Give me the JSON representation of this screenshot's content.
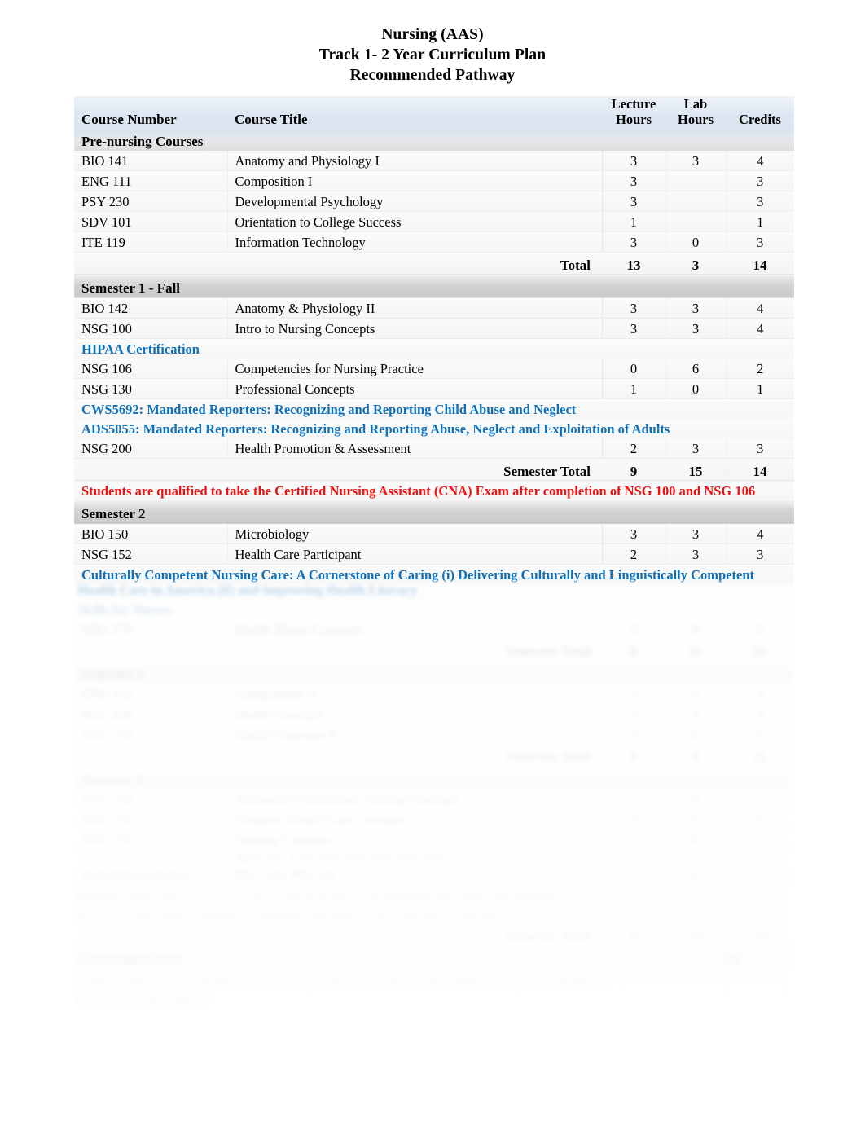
{
  "document": {
    "title_lines": [
      "Nursing (AAS)",
      "Track 1- 2 Year Curriculum Plan",
      "Recommended Pathway"
    ]
  },
  "colors": {
    "note_blue": "#1071b9",
    "note_red": "#ee1111",
    "header_blue_bg": "#d9e4f0",
    "section_gray_bg": "#d3d3d3"
  },
  "table": {
    "headers": {
      "course_number": "Course Number",
      "course_title": "Course Title",
      "lecture_hours": "Lecture\nHours",
      "lecture_hours_l1": "Lecture",
      "lecture_hours_l2": "Hours",
      "lab_hours_l1": "Lab",
      "lab_hours_l2": "Hours",
      "credits": "Credits"
    },
    "sections": [
      {
        "name": "Pre-nursing Courses",
        "style": "header-sub",
        "rows": [
          {
            "num": "BIO 141",
            "title": "Anatomy and Physiology I",
            "lecture": "3",
            "lab": "3",
            "credits": "4"
          },
          {
            "num": "ENG 111",
            "title": "Composition I",
            "lecture": "3",
            "lab": "",
            "credits": "3"
          },
          {
            "num": "PSY 230",
            "title": "Developmental Psychology",
            "lecture": "3",
            "lab": "",
            "credits": "3"
          },
          {
            "num": "SDV 101",
            "title": "Orientation to College Success",
            "lecture": "1",
            "lab": "",
            "credits": "1"
          },
          {
            "num": "ITE 119",
            "title": "Information Technology",
            "lecture": "3",
            "lab": "0",
            "credits": "3"
          }
        ],
        "total": {
          "label": "Total",
          "lecture": "13",
          "lab": "3",
          "credits": "14"
        }
      },
      {
        "name": "Semester 1 - Fall",
        "style": "section",
        "rows": [
          {
            "num": "BIO 142",
            "title": "Anatomy & Physiology II",
            "lecture": "3",
            "lab": "3",
            "credits": "4"
          },
          {
            "num": "NSG 100",
            "title": "Intro to Nursing Concepts",
            "lecture": "3",
            "lab": "3",
            "credits": "4"
          }
        ],
        "notes_after_rows": [
          {
            "text": "HIPAA Certification",
            "color": "blue"
          }
        ],
        "rows2": [
          {
            "num": "NSG 106",
            "title": "Competencies for Nursing Practice",
            "lecture": "0",
            "lab": "6",
            "credits": "2"
          },
          {
            "num": "NSG 130",
            "title": "Professional Concepts",
            "lecture": "1",
            "lab": "0",
            "credits": "1"
          }
        ],
        "notes2": [
          {
            "text": "CWS5692:  Mandated Reporters:  Recognizing and Reporting Child Abuse and Neglect",
            "color": "blue"
          },
          {
            "text": "ADS5055:  Mandated Reporters:  Recognizing and Reporting Abuse, Neglect and Exploitation of Adults",
            "color": "blue"
          }
        ],
        "rows3": [
          {
            "num": "NSG 200",
            "title": "Health Promotion & Assessment",
            "lecture": "2",
            "lab": "3",
            "credits": "3"
          }
        ],
        "total": {
          "label": "Semester Total",
          "lecture": "9",
          "lab": "15",
          "credits": "14"
        },
        "notes_end": [
          {
            "text": "Students are qualified to take the Certified Nursing Assistant (CNA) Exam after completion of NSG 100 and NSG 106",
            "color": "red"
          }
        ]
      },
      {
        "name": "Semester 2",
        "style": "section",
        "rows": [
          {
            "num": "BIO 150",
            "title": "Microbiology",
            "lecture": "3",
            "lab": "3",
            "credits": "4"
          },
          {
            "num": "NSG 152",
            "title": "Health Care Participant",
            "lecture": "2",
            "lab": "3",
            "credits": "3"
          }
        ],
        "notes_after_rows": [
          {
            "text": "Culturally Competent Nursing Care:  A Cornerstone of Caring (i) Delivering Culturally and Linguistically Competent",
            "color": "blue"
          }
        ]
      }
    ]
  },
  "faded_content": {
    "note": "Lower portion of the page fades to illegible. Glyph shapes are not readable in the source image.",
    "rows": [
      {
        "num": "",
        "title": "",
        "lecture": "",
        "lab": "",
        "credits": "",
        "kind": "note-blue-2"
      },
      {
        "num": "",
        "title": "",
        "lecture": "",
        "lab": "",
        "credits": "",
        "kind": "data"
      },
      {
        "num": "",
        "title": "",
        "lecture": "",
        "lab": "",
        "credits": "",
        "kind": "total"
      },
      {
        "num": "",
        "title": "",
        "lecture": "",
        "lab": "",
        "credits": "",
        "kind": "section"
      },
      {
        "num": "",
        "title": "",
        "lecture": "",
        "lab": "",
        "credits": "",
        "kind": "data"
      },
      {
        "num": "",
        "title": "",
        "lecture": "",
        "lab": "",
        "credits": "",
        "kind": "data"
      },
      {
        "num": "",
        "title": "",
        "lecture": "",
        "lab": "",
        "credits": "",
        "kind": "data"
      },
      {
        "num": "",
        "title": "",
        "lecture": "",
        "lab": "",
        "credits": "",
        "kind": "total"
      },
      {
        "num": "",
        "title": "",
        "lecture": "",
        "lab": "",
        "credits": "",
        "kind": "section"
      },
      {
        "num": "",
        "title": "",
        "lecture": "",
        "lab": "",
        "credits": "",
        "kind": "data"
      },
      {
        "num": "",
        "title": "",
        "lecture": "",
        "lab": "",
        "credits": "",
        "kind": "data"
      },
      {
        "num": "",
        "title": "",
        "lecture": "",
        "lab": "",
        "credits": "",
        "kind": "data"
      },
      {
        "num": "",
        "title": "",
        "lecture": "",
        "lab": "",
        "credits": "",
        "kind": "data"
      },
      {
        "num": "",
        "title": "",
        "lecture": "",
        "lab": "",
        "credits": "",
        "kind": "note-blue"
      },
      {
        "num": "",
        "title": "",
        "lecture": "",
        "lab": "",
        "credits": "",
        "kind": "note-blue"
      },
      {
        "num": "",
        "title": "",
        "lecture": "",
        "lab": "",
        "credits": "",
        "kind": "total"
      },
      {
        "num": "",
        "title": "",
        "lecture": "",
        "lab": "",
        "credits": "",
        "kind": "section"
      },
      {
        "num": "",
        "title": "",
        "lecture": "",
        "lab": "",
        "credits": "",
        "kind": "note-red"
      },
      {
        "num": "",
        "title": "",
        "lecture": "",
        "lab": "",
        "credits": "",
        "kind": "note-red"
      }
    ]
  }
}
